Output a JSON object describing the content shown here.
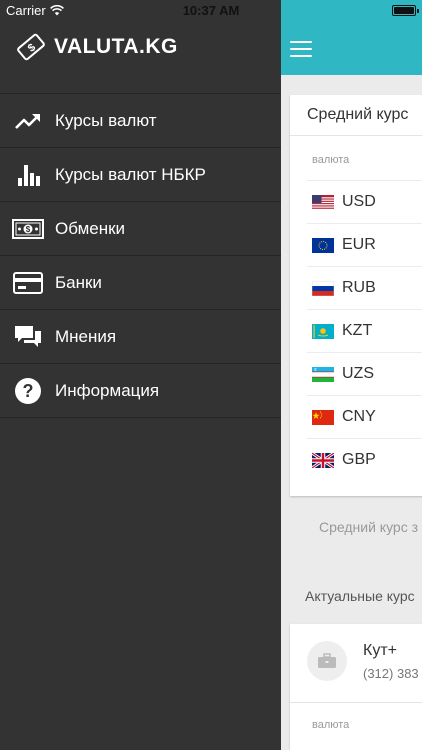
{
  "status_bar": {
    "carrier": "Carrier",
    "time": "10:37 AM"
  },
  "app": {
    "logo_text": "VALUTA.KG"
  },
  "menu": {
    "items": [
      {
        "label": "Курсы валют",
        "icon": "trending-up-icon"
      },
      {
        "label": "Курсы валют НБКР",
        "icon": "bar-chart-icon"
      },
      {
        "label": "Обменки",
        "icon": "banknote-icon"
      },
      {
        "label": "Банки",
        "icon": "credit-card-icon"
      },
      {
        "label": "Мнения",
        "icon": "chat-icon"
      },
      {
        "label": "Информация",
        "icon": "help-icon"
      }
    ]
  },
  "main": {
    "navbar_color": "#2fb8c4",
    "average_card": {
      "title": "Средний курс",
      "column_header": "валюта",
      "currencies": [
        {
          "code": "USD",
          "flag": "us-flag-icon"
        },
        {
          "code": "EUR",
          "flag": "eu-flag-icon"
        },
        {
          "code": "RUB",
          "flag": "ru-flag-icon"
        },
        {
          "code": "KZT",
          "flag": "kz-flag-icon"
        },
        {
          "code": "UZS",
          "flag": "uz-flag-icon"
        },
        {
          "code": "CNY",
          "flag": "cn-flag-icon"
        },
        {
          "code": "GBP",
          "flag": "gb-flag-icon"
        }
      ]
    },
    "footnote": "Средний курс з",
    "section_title": "Актуальные курс",
    "exchanger": {
      "name": "Кут+",
      "phone": "(312) 383",
      "column_header": "валюта"
    }
  }
}
